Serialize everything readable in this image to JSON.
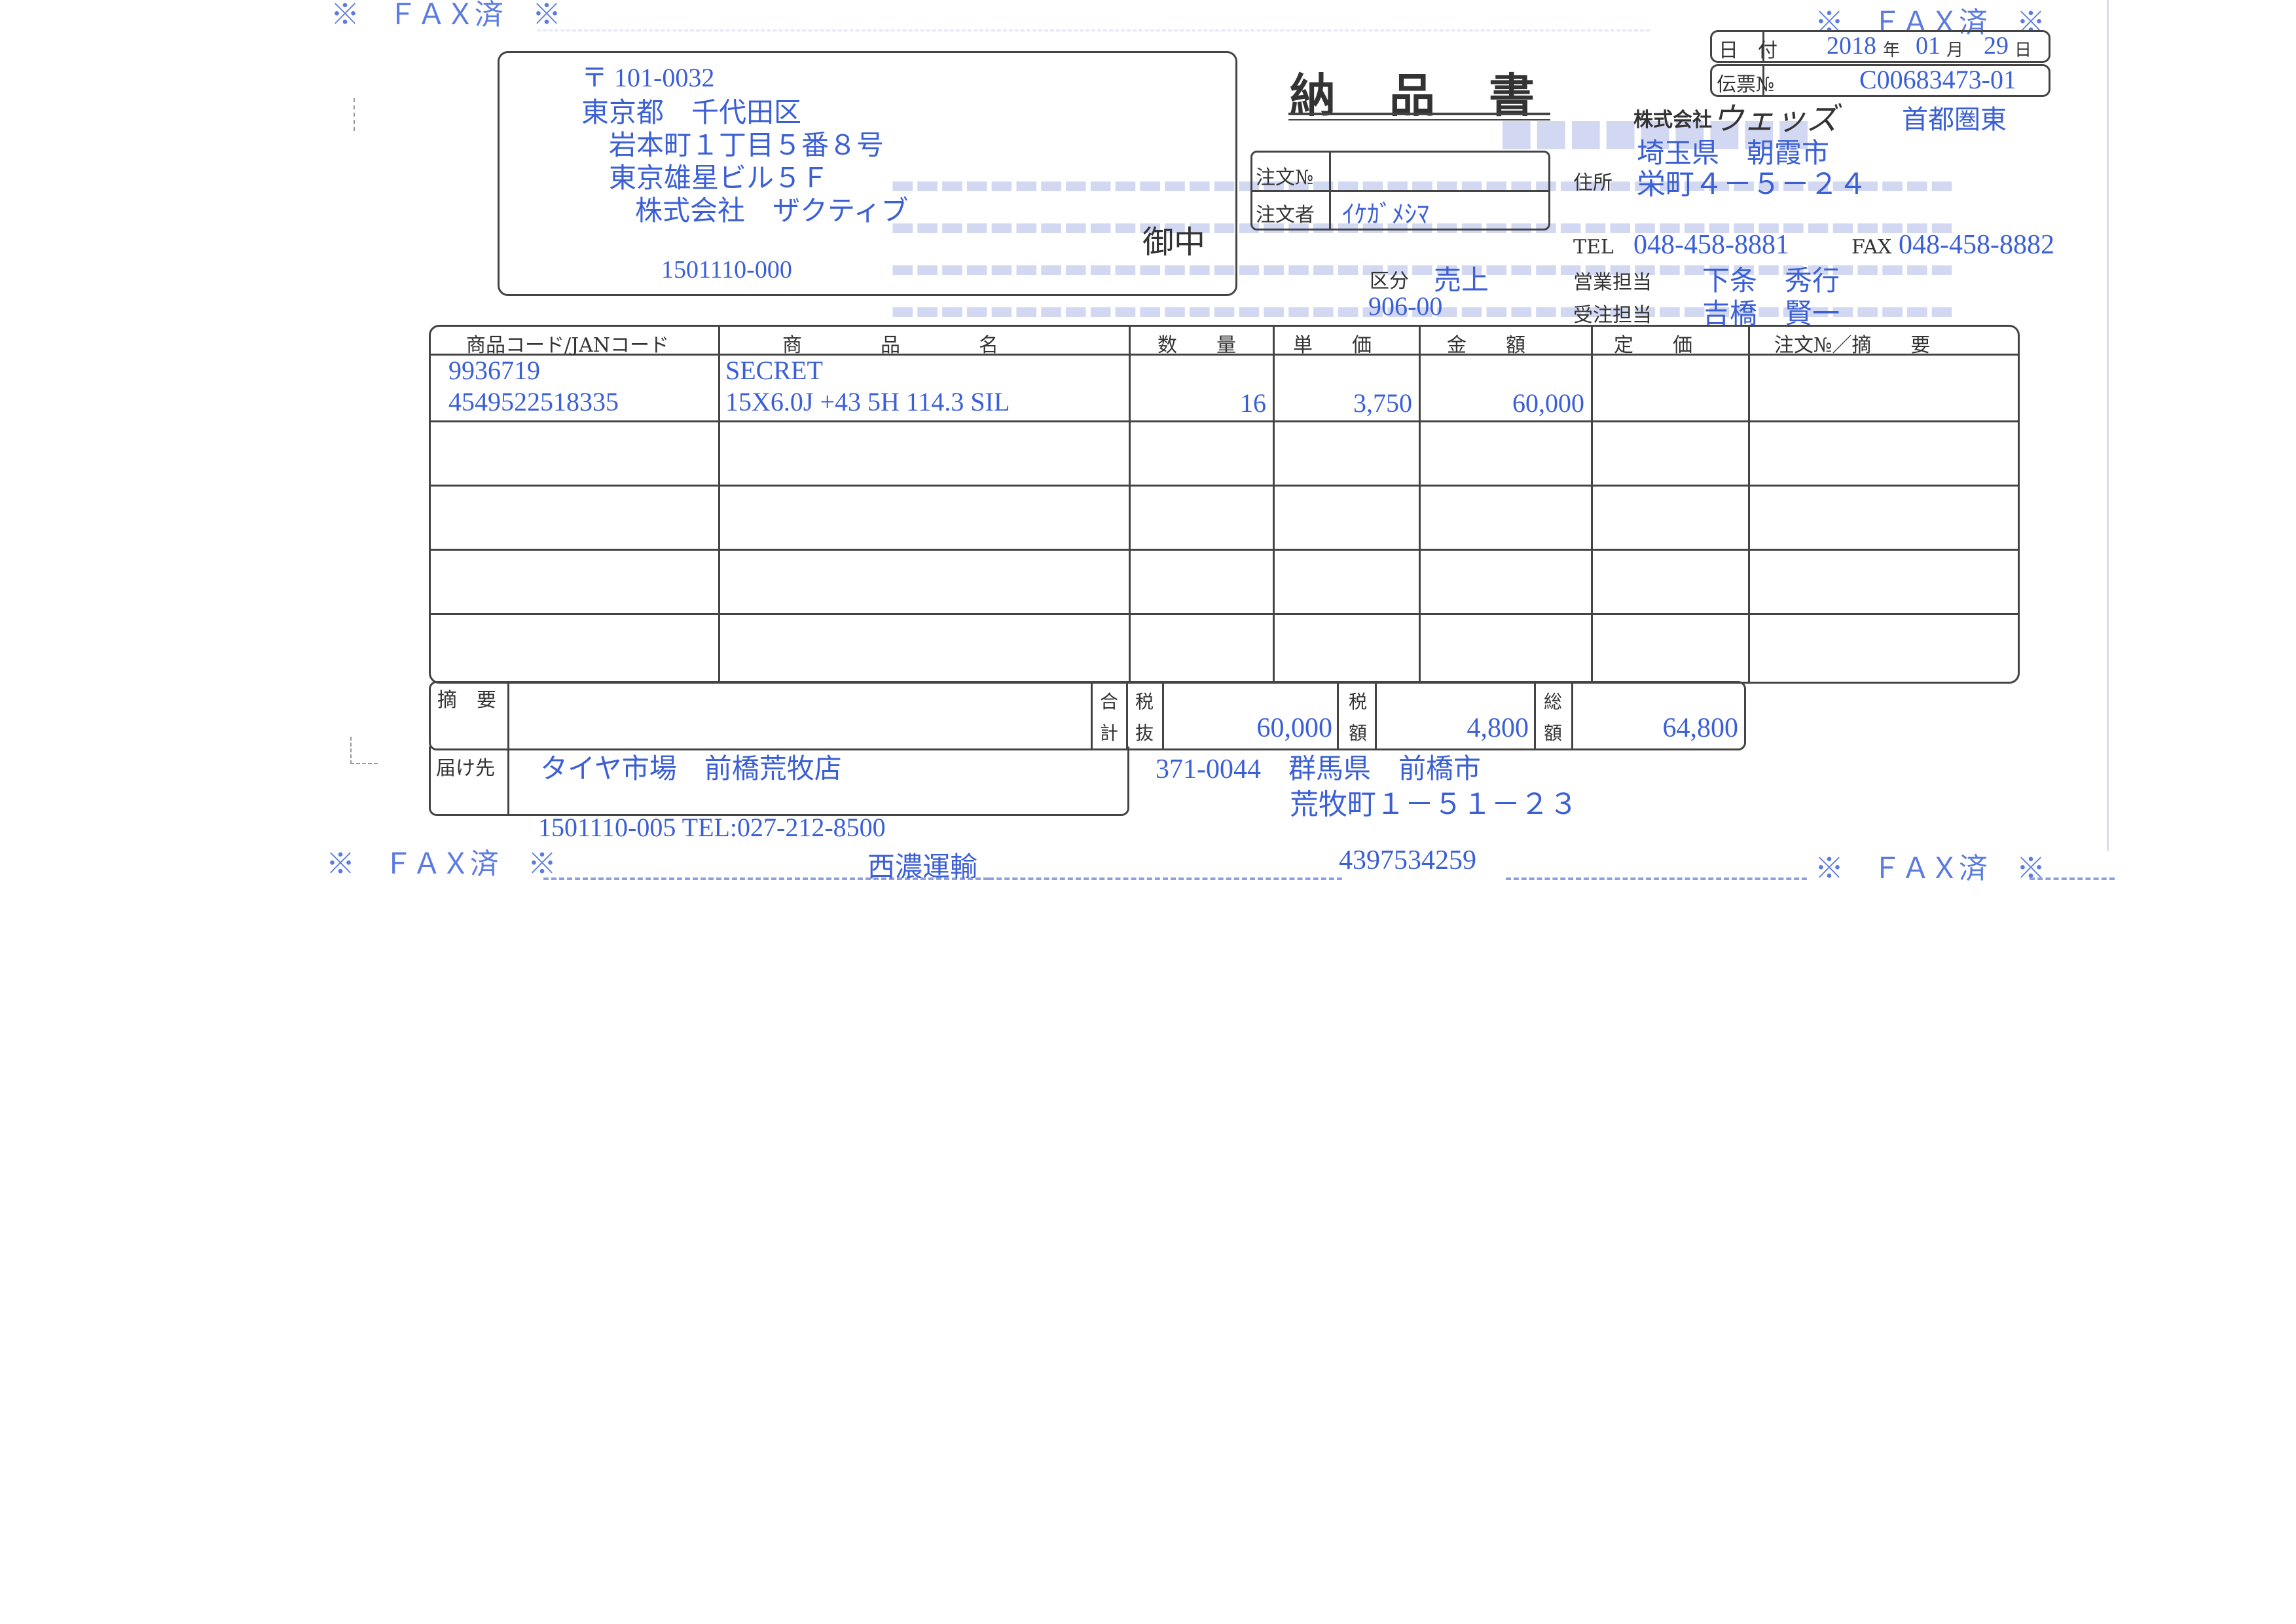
{
  "fax_stamps": {
    "top_left": "※　ＦＡＸ済　※",
    "top_right": "※　ＦＡＸ済　※",
    "bottom_left": "※　ＦＡＸ済　※",
    "bottom_right": "※　ＦＡＸ済　※"
  },
  "recipient": {
    "postal": "〒 101-0032",
    "address1": "東京都　千代田区",
    "address2": "岩本町１丁目５番８号",
    "address3": "東京雄星ビル５Ｆ",
    "company": "株式会社　ザクティブ",
    "code": "1501110-000",
    "honorific": "御中"
  },
  "document": {
    "title": "納　品　書",
    "date_label": "日　付",
    "date_year": "2018",
    "date_year_unit": "年",
    "date_month": "01",
    "date_month_unit": "月",
    "date_day": "29",
    "date_day_unit": "日",
    "slip_label": "伝票№",
    "slip_no": "C00683473-01",
    "branch": "首都圏東"
  },
  "order": {
    "order_no_label": "注文№",
    "order_no": "",
    "orderer_label": "注文者",
    "orderer": "ｲｹｶﾞﾒｼﾏ",
    "category_label": "区分",
    "category": "売上",
    "category_code": "906-00"
  },
  "sender": {
    "company_prefix": "株式会社",
    "company_name": "ウェッズ",
    "address_label": "住所",
    "address1": "埼玉県　朝霞市",
    "address2": "栄町４－５－２４",
    "tel_label": "TEL",
    "tel": "048-458-8881",
    "fax_label": "FAX",
    "fax": "048-458-8882",
    "sales_label": "営業担当",
    "sales_rep": "下条　秀行",
    "order_rep_label": "受注担当",
    "order_rep": "吉橋　賢一"
  },
  "table": {
    "headers": {
      "code": "商品コード/JANコード",
      "name": "商　　　　品　　　　名",
      "qty": "数　　量",
      "unit_price": "単　　価",
      "amount": "金　　額",
      "list_price": "定　　価",
      "note": "注文№／摘　　要"
    },
    "rows": [
      {
        "code1": "9936719",
        "code2": "4549522518335",
        "name1": "SECRET",
        "name2": "15X6.0J +43 5H 114.3 SIL",
        "qty": "16",
        "unit_price": "3,750",
        "amount": "60,000",
        "list_price": "",
        "note": ""
      }
    ]
  },
  "totals": {
    "remarks_label": "摘　要",
    "subtotal_label_a": "合",
    "subtotal_label_b": "計",
    "subtotal_label_c": "税",
    "subtotal_label_d": "抜",
    "subtotal": "60,000",
    "tax_label_a": "税",
    "tax_label_b": "額",
    "tax": "4,800",
    "total_label_a": "総",
    "total_label_b": "額",
    "total": "64,800"
  },
  "delivery": {
    "label": "届け先",
    "name": "タイヤ市場　前橋荒牧店",
    "postal_address": "371-0044　群馬県　前橋市",
    "address2": "荒牧町１－５１－２３",
    "code_tel": "1501110-005 TEL:027-212-8500",
    "carrier": "西濃運輸",
    "tracking": "4397534259"
  }
}
